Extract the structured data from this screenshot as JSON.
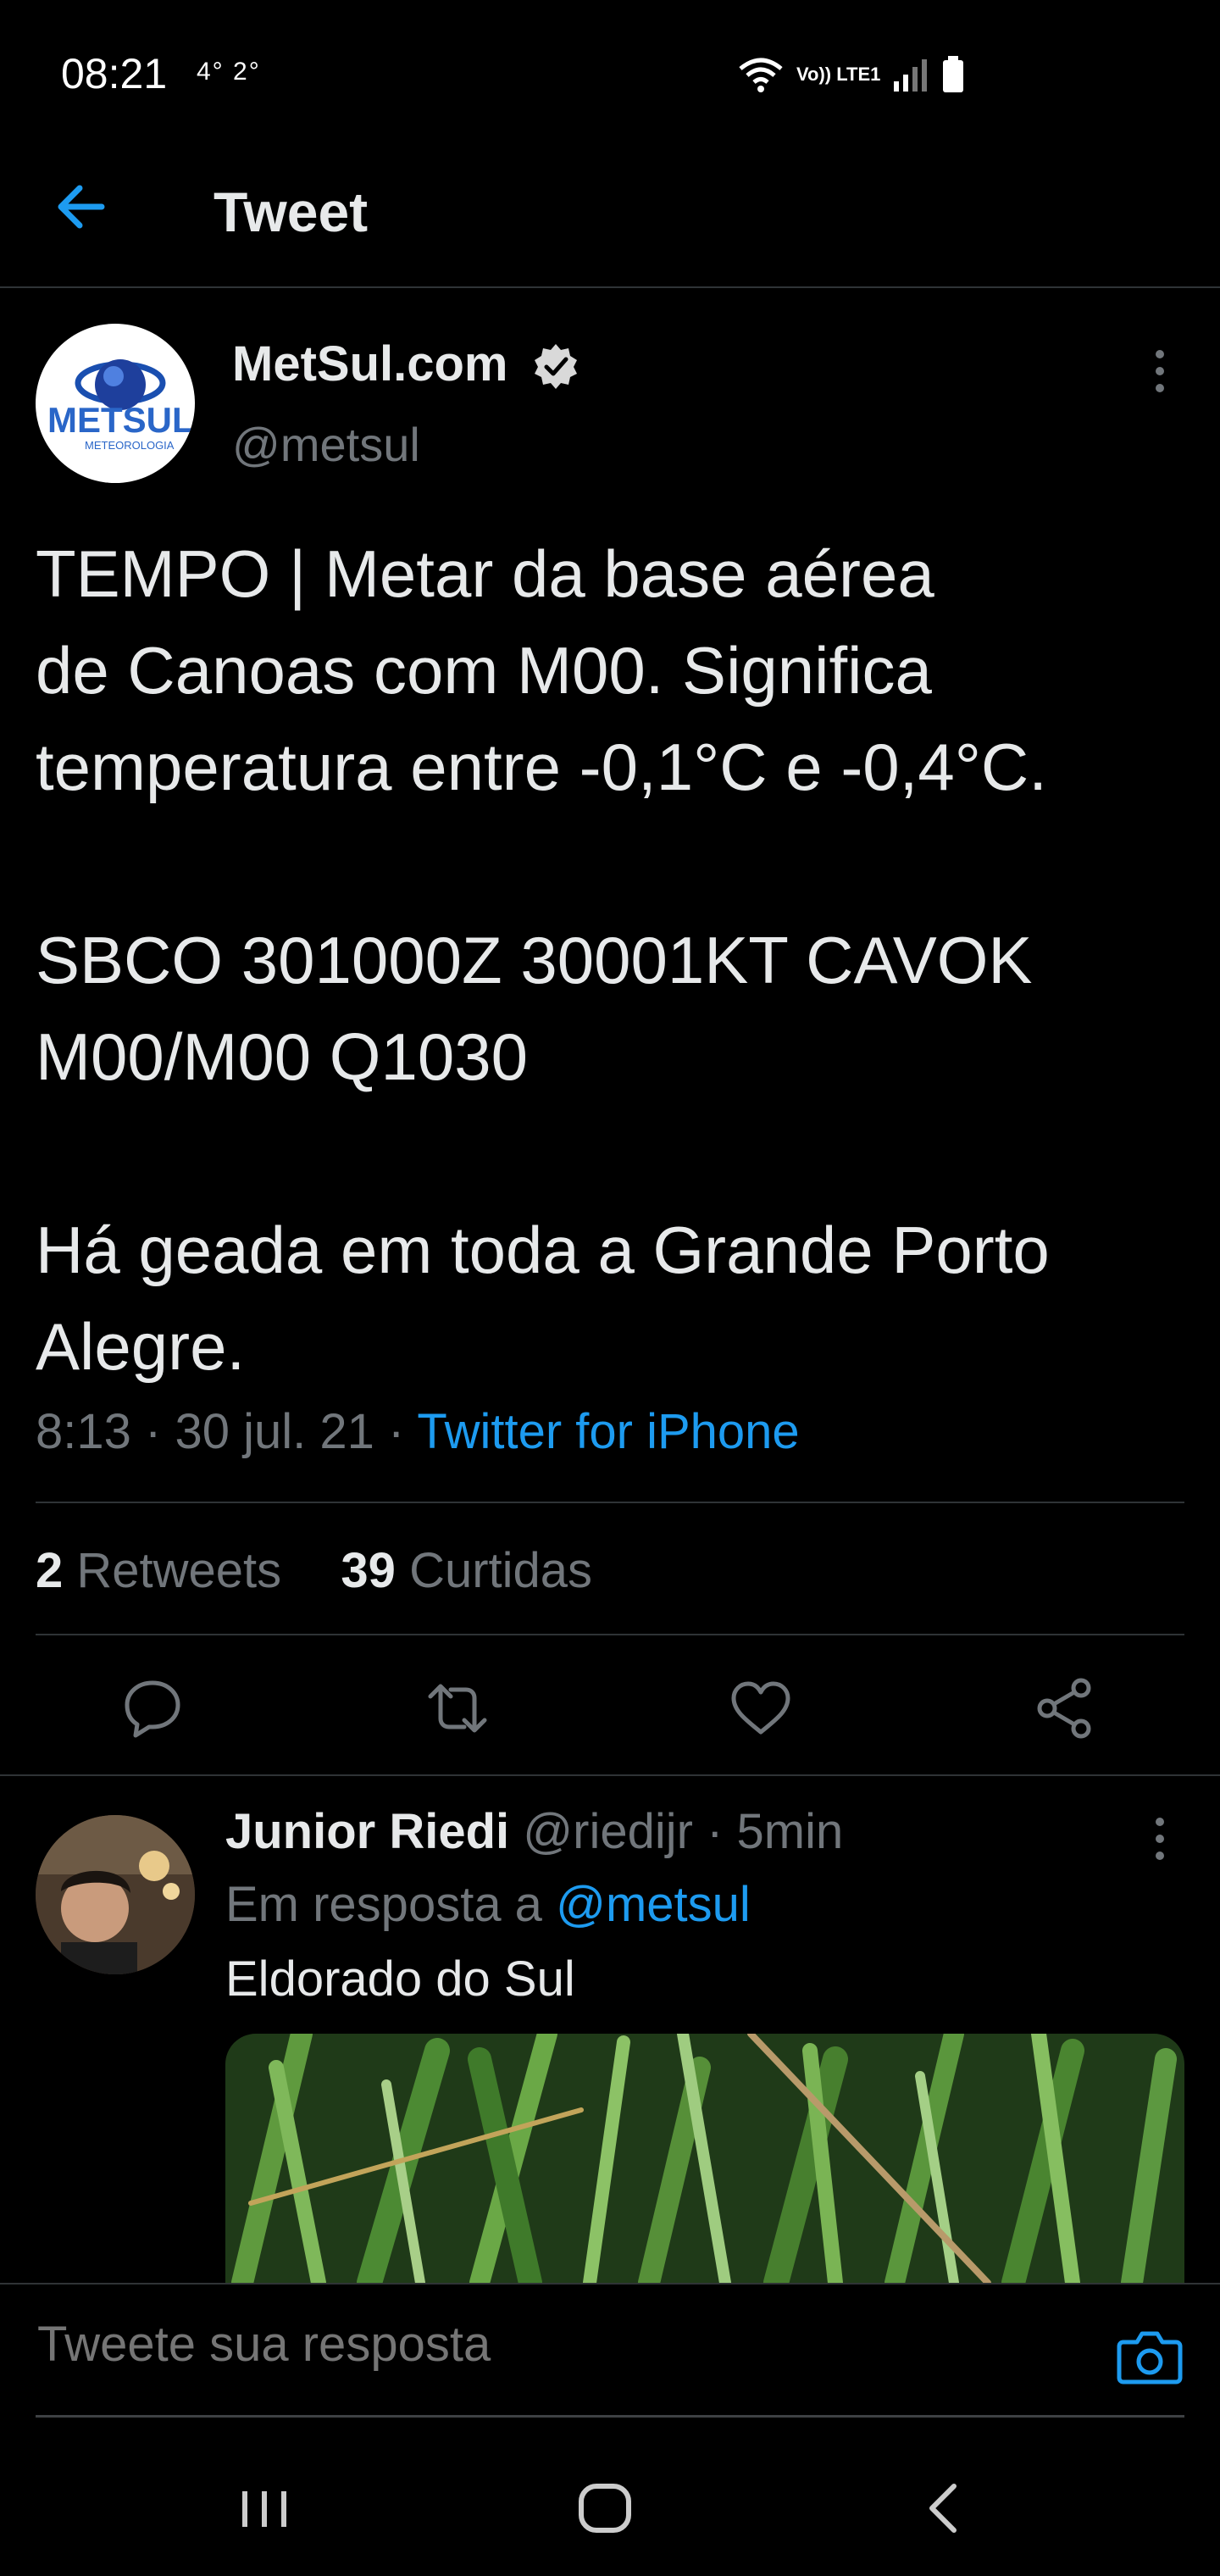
{
  "status_bar": {
    "time": "08:21",
    "temps": "4° 2°",
    "network": "Vo)) LTE1"
  },
  "header": {
    "title": "Tweet",
    "back_icon": "arrow-left-icon"
  },
  "tweet": {
    "author_name": "MetSul.com",
    "author_handle": "@metsul",
    "avatar_logo_text": "METSUL",
    "avatar_logo_subtext": "METEOROLOGIA",
    "text": "TEMPO | Metar da base aérea\nde Canoas com M00. Significa\ntemperatura entre -0,1°C e -0,4°C.\n\nSBCO 301000Z 30001KT CAVOK\nM00/M00 Q1030\n\nHá geada em toda a Grande Porto\nAlegre.",
    "time": "8:13",
    "date": "30 jul. 21",
    "source": "Twitter for iPhone",
    "retweets_count": "2",
    "retweets_label": "Retweets",
    "likes_count": "39",
    "likes_label": "Curtidas"
  },
  "actions": [
    "reply-icon",
    "retweet-icon",
    "like-icon",
    "share-icon"
  ],
  "reply": {
    "author_name": "Junior Riedi",
    "author_handle": "@riedijr",
    "time_ago": "5min",
    "reply_prefix": "Em resposta a",
    "reply_mention": "@metsul",
    "text": "Eldorado do Sul"
  },
  "composer": {
    "placeholder": "Tweete sua resposta"
  },
  "colors": {
    "background": "#000000",
    "accent": "#1d9bf0",
    "secondary_text": "#71767b",
    "primary_text": "#e7e9ea"
  }
}
